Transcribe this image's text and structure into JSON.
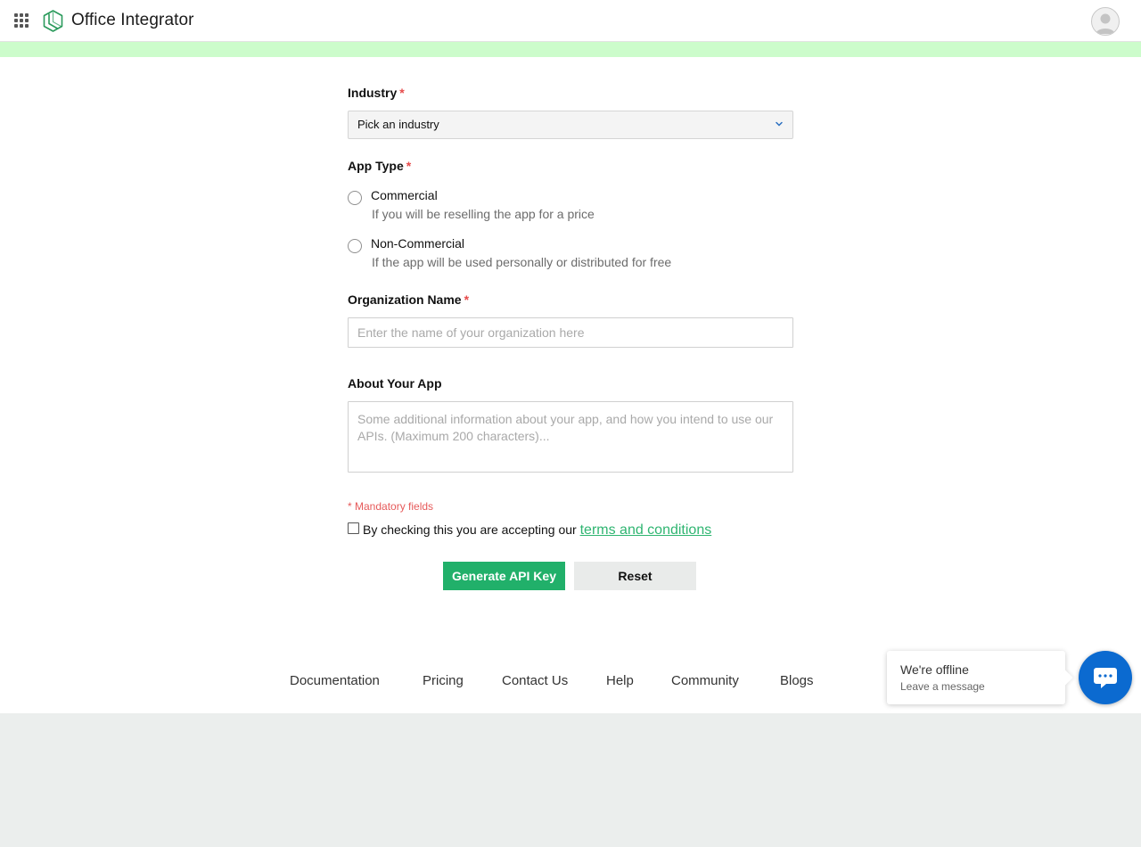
{
  "header": {
    "app_title": "Office Integrator",
    "apps_icon": "grid-apps-icon",
    "logo_icon": "office-integrator-logo",
    "avatar_icon": "user-avatar-icon",
    "brand_color": "#21b06a",
    "notice_band_color": "#ccfccb"
  },
  "form": {
    "industry": {
      "label": "Industry",
      "required_mark": "*",
      "selected": "Pick an industry",
      "chevron_icon": "chevron-down-icon"
    },
    "app_type": {
      "label": "App Type",
      "required_mark": "*",
      "options": [
        {
          "title": "Commercial",
          "description": "If you will be reselling the app for a price"
        },
        {
          "title": "Non-Commercial",
          "description": "If the app will be used personally or distributed for free"
        }
      ]
    },
    "org_name": {
      "label": "Organization Name",
      "required_mark": "*",
      "placeholder": "Enter the name of your organization here",
      "value": ""
    },
    "about_app": {
      "label": "About Your App",
      "placeholder": "Some additional information about your app, and how you intend to use our APIs. (Maximum 200 characters)...",
      "value": ""
    },
    "mandatory_note": "* Mandatory fields",
    "accept_text": "By checking this you are accepting our",
    "terms_link": "terms and conditions",
    "generate_button": "Generate API Key",
    "reset_button": "Reset"
  },
  "footer": {
    "links": [
      "Documentation",
      "Pricing",
      "Contact Us",
      "Help",
      "Community",
      "Blogs"
    ]
  },
  "chat": {
    "status": "We're offline",
    "subtext": "Leave a message",
    "icon": "chat-bubble-icon",
    "color": "#0b6ad0"
  }
}
